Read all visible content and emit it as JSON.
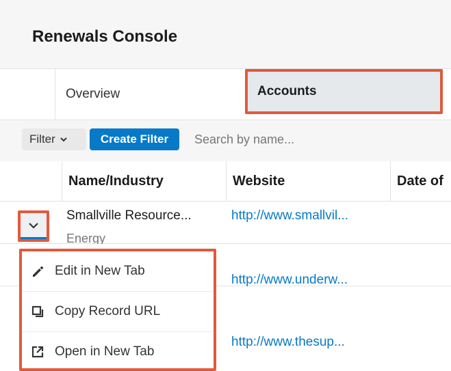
{
  "header": {
    "title": "Renewals Console"
  },
  "tabs": [
    {
      "label": "Overview"
    },
    {
      "label": "Accounts"
    }
  ],
  "filter": {
    "dropdown_label": "Filter",
    "create_label": "Create Filter",
    "search_placeholder": "Search by name..."
  },
  "table": {
    "columns": [
      "Name/Industry",
      "Website",
      "Date of"
    ],
    "rows": [
      {
        "name": "Smallville Resource...",
        "industry": "Energy",
        "website": "http://www.smallvil..."
      },
      {
        "name": ".",
        "industry": "",
        "website": "http://www.underw..."
      },
      {
        "name": "",
        "industry": "",
        "website": "http://www.thesup..."
      }
    ]
  },
  "row_actions": {
    "items": [
      {
        "label": "Edit in New Tab",
        "icon": "pencil-icon"
      },
      {
        "label": "Copy Record URL",
        "icon": "copy-icon"
      },
      {
        "label": "Open in New Tab",
        "icon": "external-link-icon"
      }
    ]
  },
  "colors": {
    "accent": "#0679c8",
    "highlight": "#e05a3c"
  }
}
